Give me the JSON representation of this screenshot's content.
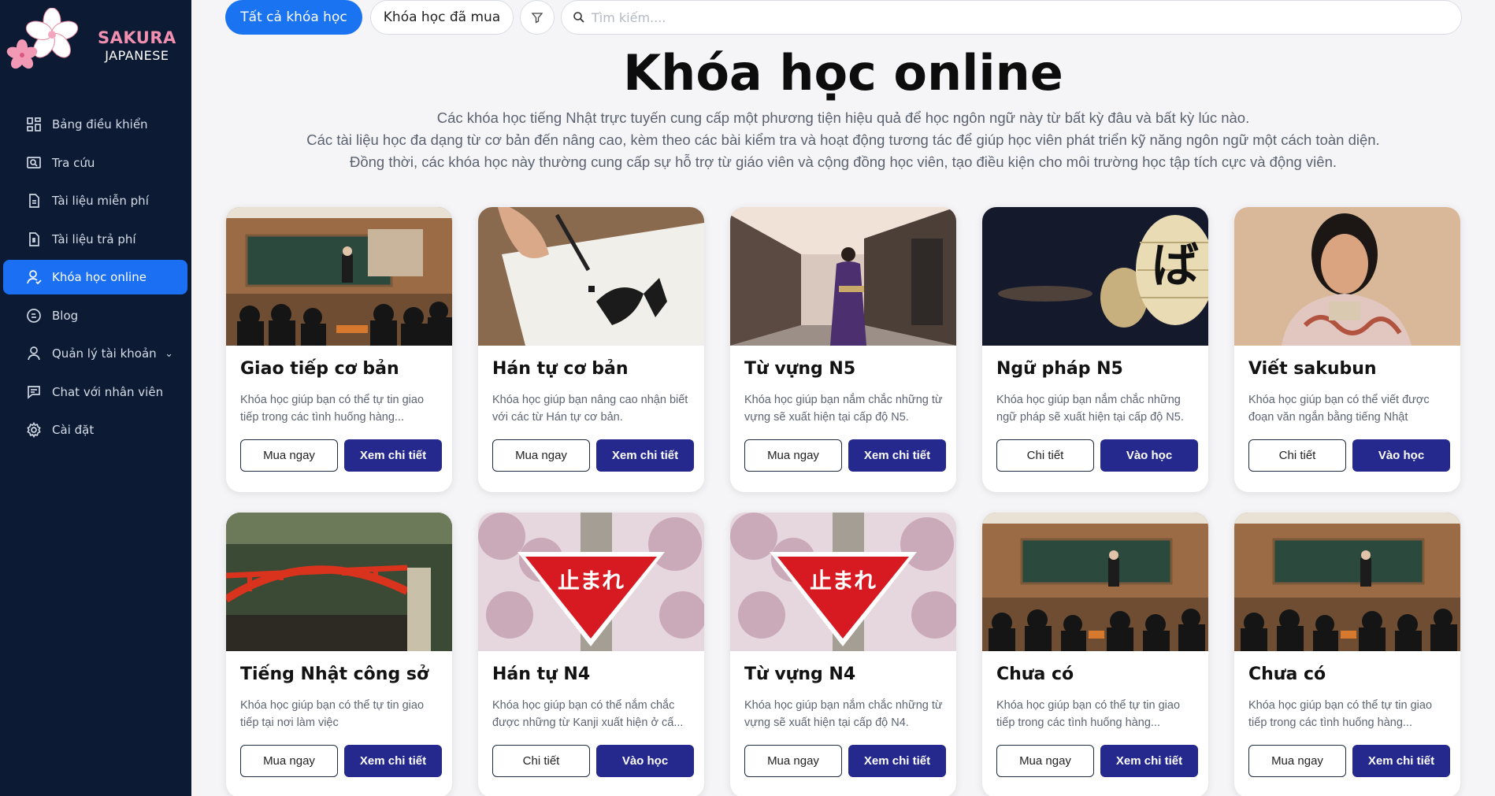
{
  "brand": {
    "title": "SAKURA",
    "subtitle": "JAPANESE"
  },
  "sidebar": {
    "items": [
      {
        "label": "Bảng điều khiển",
        "icon": "dashboard-icon",
        "active": false
      },
      {
        "label": "Tra cứu",
        "icon": "lookup-icon",
        "active": false
      },
      {
        "label": "Tài liệu miễn phí",
        "icon": "document-icon",
        "active": false
      },
      {
        "label": "Tài liệu trả phí",
        "icon": "paid-document-icon",
        "active": false
      },
      {
        "label": "Khóa học online",
        "icon": "course-user-icon",
        "active": true
      },
      {
        "label": "Blog",
        "icon": "blog-icon",
        "active": false
      },
      {
        "label": "Quản lý tài khoản",
        "icon": "user-icon",
        "active": false
      },
      {
        "label": "Chat với nhân viên",
        "icon": "chat-icon",
        "active": false
      },
      {
        "label": "Cài đặt",
        "icon": "settings-icon",
        "active": false
      }
    ]
  },
  "topbar": {
    "tab_all": "Tất cả khóa học",
    "tab_bought": "Khóa học đã mua",
    "search_placeholder": "Tìm kiếm...."
  },
  "page": {
    "title": "Khóa học online",
    "desc_line1": "Các khóa học tiếng Nhật trực tuyến cung cấp một phương tiện hiệu quả để học ngôn ngữ này từ bất kỳ đâu và bất kỳ lúc nào.",
    "desc_line2": "Các tài liệu học đa dạng từ cơ bản đến nâng cao, kèm theo các bài kiểm tra và hoạt động tương tác để giúp học viên phát triển kỹ năng ngôn ngữ một cách toàn diện.",
    "desc_line3": "Đồng thời, các khóa học này thường cung cấp sự hỗ trợ từ giáo viên và cộng đồng học viên, tạo điều kiện cho môi trường học tập tích cực và động viên."
  },
  "courses": [
    {
      "title": "Giao tiếp cơ bản",
      "text": "Khóa học giúp bạn có thể tự tin giao tiếp trong các tình huống hàng...",
      "btn1": "Mua ngay",
      "btn2": "Xem chi tiết",
      "image": "classroom"
    },
    {
      "title": "Hán tự cơ bản",
      "text": "Khóa học giúp bạn nâng cao nhận biết với các từ Hán tự cơ bản.",
      "btn1": "Mua ngay",
      "btn2": "Xem chi tiết",
      "image": "calligraphy"
    },
    {
      "title": "Từ vựng N5",
      "text": "Khóa học giúp bạn nắm chắc những từ vựng sẽ xuất hiện tại cấp độ N5.",
      "btn1": "Mua ngay",
      "btn2": "Xem chi tiết",
      "image": "street"
    },
    {
      "title": "Ngữ pháp N5",
      "text": "Khóa học giúp bạn nắm chắc những ngữ pháp sẽ xuất hiện tại cấp độ N5.",
      "btn1": "Chi tiết",
      "btn2": "Vào học",
      "image": "lantern",
      "lantern_text": "ば"
    },
    {
      "title": "Viết sakubun",
      "text": "Khóa học giúp bạn có thể viết được đoạn văn ngắn bằng tiếng Nhật",
      "btn1": "Chi tiết",
      "btn2": "Vào học",
      "image": "portrait"
    },
    {
      "title": "Tiếng Nhật công sở",
      "text": "Khóa học giúp bạn có thể tự tin giao tiếp tại nơi làm việc",
      "btn1": "Mua ngay",
      "btn2": "Xem chi tiết",
      "image": "bridge"
    },
    {
      "title": "Hán tự N4",
      "text": "Khóa học giúp bạn có thể nắm chắc được những từ Kanji xuất hiện ở cấ...",
      "btn1": "Chi tiết",
      "btn2": "Vào học",
      "image": "stopsign",
      "sign_text": "止まれ"
    },
    {
      "title": "Từ vựng N4",
      "text": "Khóa học giúp bạn nắm chắc những từ vựng sẽ xuất hiện tại cấp độ N4.",
      "btn1": "Mua ngay",
      "btn2": "Xem chi tiết",
      "image": "stopsign",
      "sign_text": "止まれ"
    },
    {
      "title": "Chưa có",
      "text": "Khóa học giúp bạn có thể tự tin giao tiếp trong các tình huống hàng...",
      "btn1": "Mua ngay",
      "btn2": "Xem chi tiết",
      "image": "classroom"
    },
    {
      "title": "Chưa có",
      "text": "Khóa học giúp bạn có thể tự tin giao tiếp trong các tình huống hàng...",
      "btn1": "Mua ngay",
      "btn2": "Xem chi tiết",
      "image": "classroom"
    }
  ],
  "colors": {
    "sidebar_bg": "#0c1a33",
    "accent": "#1a73f0",
    "button_dark": "#25288c",
    "brand_pink": "#f08fb0"
  }
}
